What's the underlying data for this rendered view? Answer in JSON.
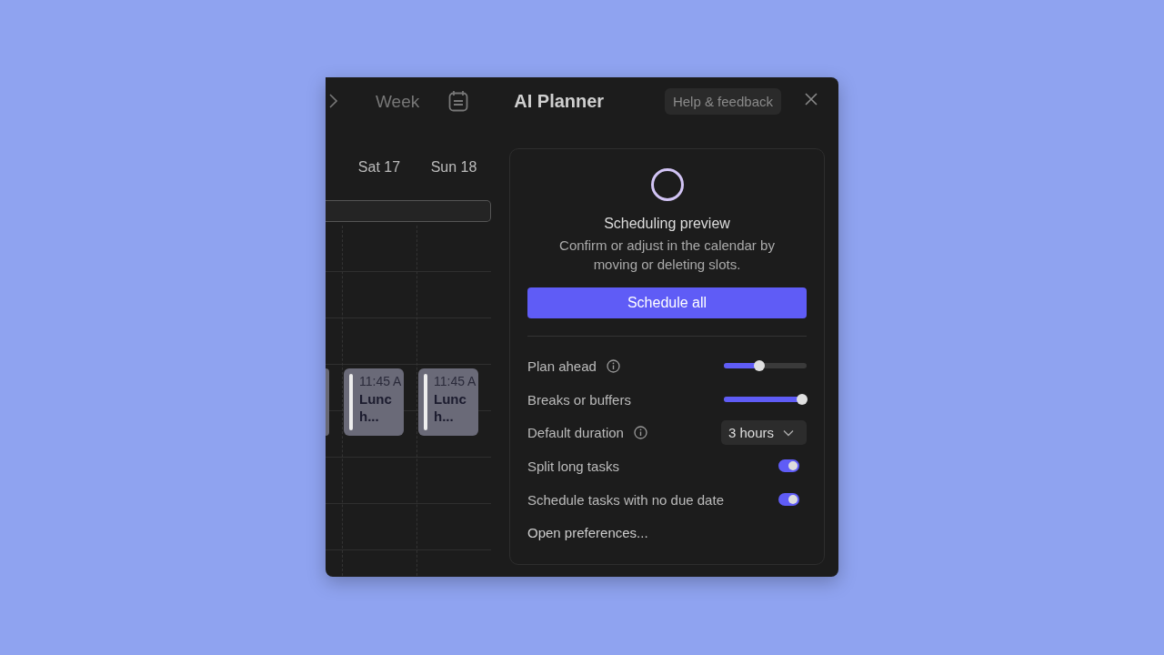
{
  "header": {
    "view": "Week",
    "title": "AI Planner",
    "help_button": "Help & feedback"
  },
  "calendar": {
    "days": [
      {
        "label": "Sat 17"
      },
      {
        "label": "Sun 18"
      }
    ],
    "events": [
      {
        "time": "11:45 A",
        "title": "Lunch..."
      },
      {
        "time": "11:45 A",
        "title": "Lunch..."
      }
    ]
  },
  "panel": {
    "title": "Scheduling preview",
    "description": "Confirm or adjust in the calendar by moving or deleting slots.",
    "button": "Schedule all",
    "settings": [
      {
        "kind": "slider",
        "label": "Plan ahead",
        "info": true,
        "level": 0.43
      },
      {
        "kind": "slider",
        "label": "Breaks or buffers",
        "info": false,
        "level": 0.95
      },
      {
        "kind": "dropdown",
        "label": "Default duration",
        "info": true,
        "value": "3 hours"
      },
      {
        "kind": "toggle",
        "label": "Split long tasks",
        "info": false,
        "on": true
      },
      {
        "kind": "toggle",
        "label": "Schedule tasks with no due date",
        "info": false,
        "on": true
      },
      {
        "kind": "link",
        "label": "Open preferences..."
      }
    ]
  }
}
